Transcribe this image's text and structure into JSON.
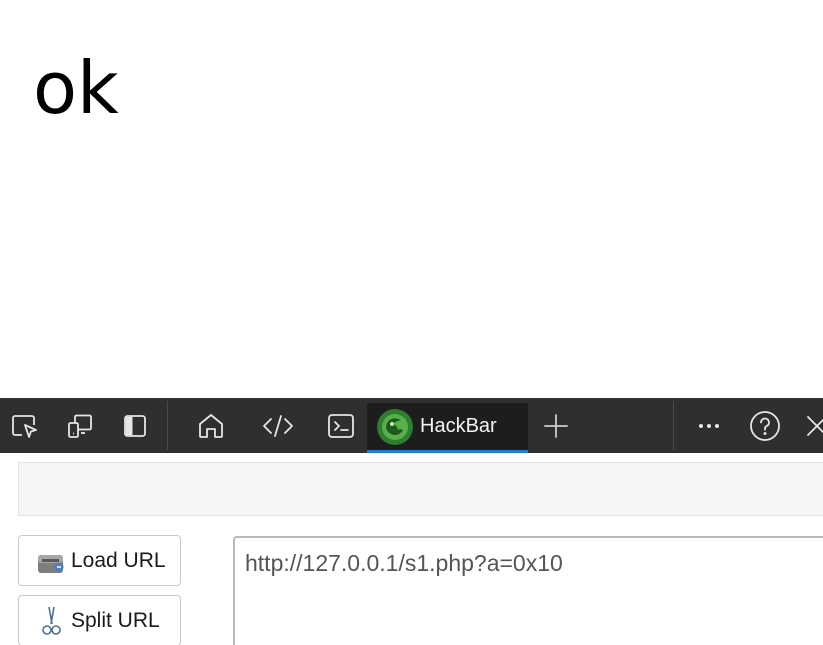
{
  "page": {
    "output_text": "ok"
  },
  "devtools": {
    "toolbar_buttons": [
      {
        "id": "inspect",
        "icon": "inspect-element-icon"
      },
      {
        "id": "device",
        "icon": "device-emulation-icon"
      },
      {
        "id": "dock",
        "icon": "dock-side-icon"
      },
      {
        "id": "welcome",
        "icon": "home-icon"
      },
      {
        "id": "elements",
        "icon": "code-brackets-icon"
      },
      {
        "id": "console",
        "icon": "console-icon"
      }
    ],
    "active_tab": {
      "label": "HackBar",
      "icon": "hackbar-logo-icon"
    },
    "right_buttons": [
      {
        "id": "more",
        "icon": "more-options-icon"
      },
      {
        "id": "help",
        "icon": "help-icon"
      },
      {
        "id": "close",
        "icon": "close-icon"
      }
    ],
    "colors": {
      "toolbar_bg": "#2f2f2f",
      "active_tab_bg": "#1d1d1d",
      "active_indicator": "#1f7ad8"
    }
  },
  "hackbar": {
    "load_url_label": "Load URL",
    "split_url_label": "Split URL",
    "url_value": "http://127.0.0.1/s1.php?a=0x10"
  }
}
